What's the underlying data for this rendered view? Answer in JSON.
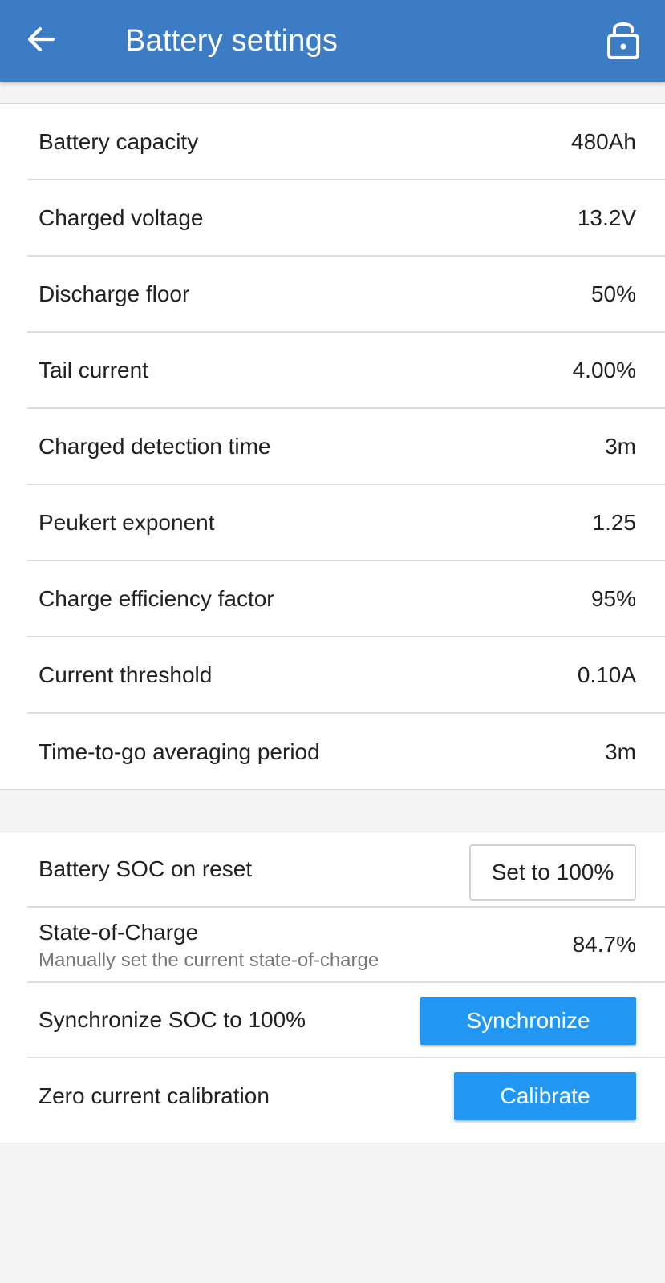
{
  "header": {
    "title": "Battery settings",
    "back_icon": "arrow-left-icon",
    "lock_icon": "lock-open-icon",
    "background_color": "#3b7cc4"
  },
  "settings": [
    {
      "label": "Battery capacity",
      "value": "480Ah"
    },
    {
      "label": "Charged voltage",
      "value": "13.2V"
    },
    {
      "label": "Discharge floor",
      "value": "50%"
    },
    {
      "label": "Tail current",
      "value": "4.00%"
    },
    {
      "label": "Charged detection time",
      "value": "3m"
    },
    {
      "label": "Peukert exponent",
      "value": "1.25"
    },
    {
      "label": "Charge efficiency factor",
      "value": "95%"
    },
    {
      "label": "Current threshold",
      "value": "0.10A"
    },
    {
      "label": "Time-to-go averaging period",
      "value": "3m"
    }
  ],
  "actions": {
    "soc_reset": {
      "label": "Battery SOC on reset",
      "button": "Set to 100%"
    },
    "state_of_charge": {
      "label": "State-of-Charge",
      "description": "Manually set the current state-of-charge",
      "value": "84.7%"
    },
    "synchronize": {
      "label": "Synchronize SOC to 100%",
      "button": "Synchronize"
    },
    "calibration": {
      "label": "Zero current calibration",
      "button": "Calibrate"
    },
    "button_color": "#2196f3"
  }
}
